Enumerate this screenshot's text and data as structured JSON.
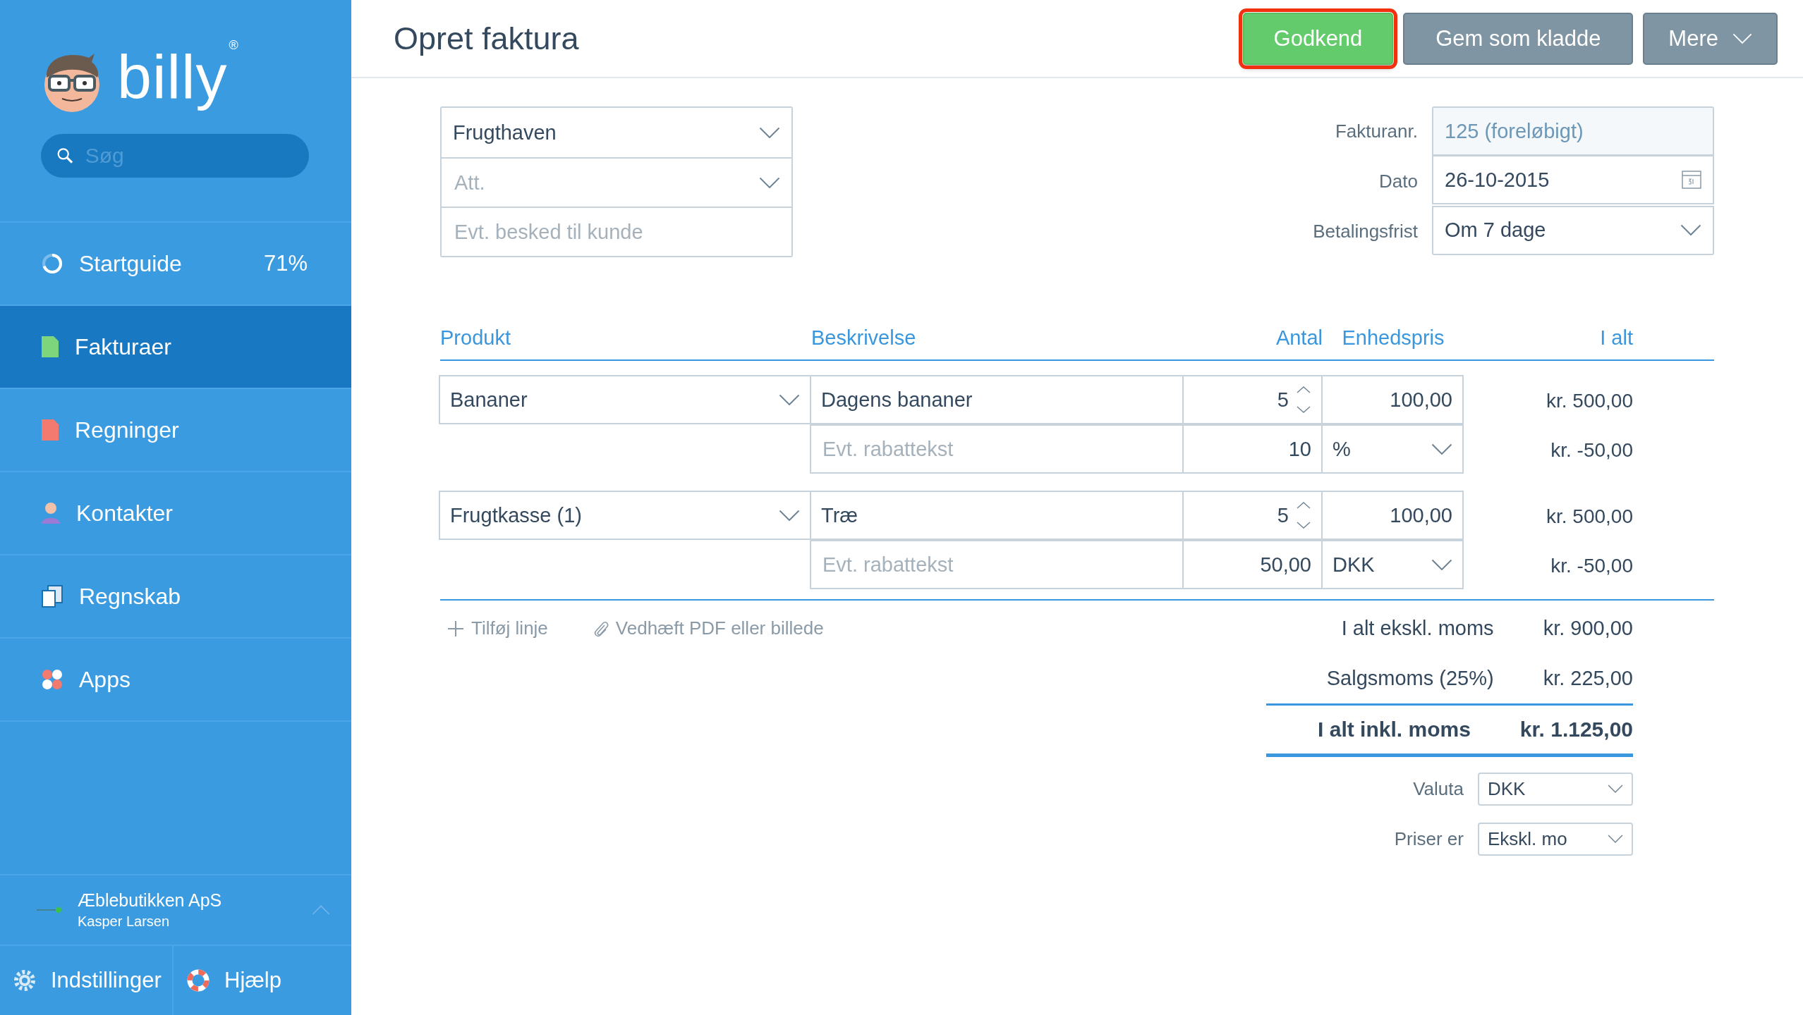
{
  "sidebar": {
    "logo": "billy",
    "logo_mark": "®",
    "search": {
      "placeholder": "Søg"
    },
    "nav": [
      {
        "label": "Startguide",
        "kind": "progress",
        "badge": "71%",
        "selected": false
      },
      {
        "label": "Fakturaer",
        "kind": "invoices",
        "selected": true
      },
      {
        "label": "Regninger",
        "kind": "bills",
        "selected": false
      },
      {
        "label": "Kontakter",
        "kind": "contacts",
        "selected": false
      },
      {
        "label": "Regnskab",
        "kind": "accounting",
        "selected": false
      },
      {
        "label": "Apps",
        "kind": "apps",
        "selected": false
      }
    ],
    "account": {
      "company": "Æblebutikken ApS",
      "user": "Kasper Larsen"
    },
    "footer": [
      {
        "label": "Indstillinger",
        "kind": "settings"
      },
      {
        "label": "Hjælp",
        "kind": "help"
      }
    ]
  },
  "header": {
    "title": "Opret faktura",
    "buttons": [
      {
        "label": "Godkend",
        "kind": "primary",
        "highlighted": true
      },
      {
        "label": "Gem som kladde",
        "kind": "secondary",
        "highlighted": false
      },
      {
        "label": "Mere",
        "kind": "menu",
        "highlighted": false
      }
    ]
  },
  "customer": {
    "contact": "Frugthaven",
    "attention": {
      "placeholder": "Att."
    },
    "message": {
      "placeholder": "Evt. besked til kunde"
    }
  },
  "invoice_meta": [
    {
      "label": "Fakturanr.",
      "value": "125 (foreløbigt)",
      "kind": "readonly"
    },
    {
      "label": "Dato",
      "value": "26-10-2015",
      "kind": "date"
    },
    {
      "label": "Betalingsfrist",
      "value": "Om 7 dage",
      "kind": "select"
    }
  ],
  "table": {
    "columns": [
      "Produkt",
      "Beskrivelse",
      "Antal",
      "Enhedspris",
      "I alt"
    ],
    "lines": [
      {
        "product": "Bananer",
        "description": "Dagens bananer",
        "quantity": "5",
        "unit_price": "100,00",
        "total": "kr. 500,00",
        "discount": {
          "placeholder": "Evt. rabattekst",
          "value": "10",
          "unit": "%",
          "total": "kr. -50,00"
        }
      },
      {
        "product": "Frugtkasse (1)",
        "description": "Træ",
        "quantity": "5",
        "unit_price": "100,00",
        "total": "kr. 500,00",
        "discount": {
          "placeholder": "Evt. rabattekst",
          "value": "50,00",
          "unit": "DKK",
          "total": "kr. -50,00"
        }
      }
    ]
  },
  "actions": [
    {
      "label": "Tilføj linje",
      "kind": "add"
    },
    {
      "label": "Vedhæft PDF eller billede",
      "kind": "attach"
    }
  ],
  "totals": [
    {
      "label": "I alt ekskl. moms",
      "value": "kr. 900,00",
      "kind": "subtotal"
    },
    {
      "label": "Salgsmoms (25%)",
      "value": "kr. 225,00",
      "kind": "tax"
    },
    {
      "label": "I alt inkl. moms",
      "value": "kr. 1.125,00",
      "kind": "grand"
    }
  ],
  "settings": [
    {
      "label": "Valuta",
      "value": "DKK"
    },
    {
      "label": "Priser er",
      "value": "Ekskl. mo"
    }
  ]
}
